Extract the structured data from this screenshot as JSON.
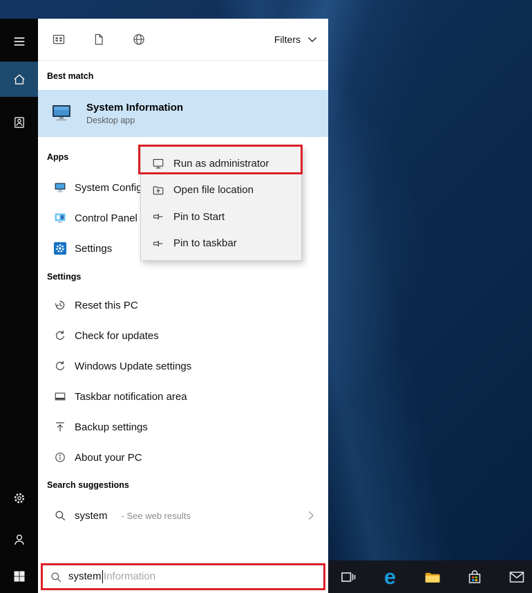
{
  "colors": {
    "accent": "#0078d7",
    "best_match_highlight": "#cbe3f6",
    "annotation_red": "#dd2027",
    "sidebar_active": "#1d4a6f",
    "taskbar": "#14171d"
  },
  "filter_bar": {
    "icons": [
      "apps-filter-icon",
      "documents-filter-icon",
      "web-filter-icon"
    ],
    "filters_label": "Filters"
  },
  "best_match": {
    "header": "Best match",
    "title": "System Information",
    "subtitle": "Desktop app"
  },
  "apps_section": {
    "header": "Apps",
    "items": [
      {
        "label": "System Configuration"
      },
      {
        "label": "Control Panel"
      },
      {
        "label": "Settings"
      }
    ]
  },
  "settings_section": {
    "header": "Settings",
    "items": [
      {
        "label": "Reset this PC",
        "icon": "history-icon"
      },
      {
        "label": "Check for updates",
        "icon": "refresh-icon"
      },
      {
        "label": "Windows Update settings",
        "icon": "refresh-icon"
      },
      {
        "label": "Taskbar notification area",
        "icon": "taskbar-rect-icon"
      },
      {
        "label": "Backup settings",
        "icon": "upload-icon"
      },
      {
        "label": "About your PC",
        "icon": "info-icon"
      }
    ]
  },
  "suggestions_section": {
    "header": "Search suggestions",
    "query": "system",
    "hint": "- See web results"
  },
  "context_menu": {
    "items": [
      {
        "label": "Run as administrator",
        "annotated": true
      },
      {
        "label": "Open file location"
      },
      {
        "label": "Pin to Start"
      },
      {
        "label": "Pin to taskbar"
      }
    ]
  },
  "search_box": {
    "value": "system",
    "ghost": "Information"
  },
  "sidebar": {
    "icons": [
      "hamburger-icon",
      "home-icon",
      "collection-icon",
      "gear-icon",
      "user-icon",
      "windows-start-icon"
    ]
  },
  "taskbar": {
    "icons": [
      "task-view-icon",
      "edge-icon",
      "file-explorer-icon",
      "store-icon",
      "mail-icon"
    ]
  }
}
